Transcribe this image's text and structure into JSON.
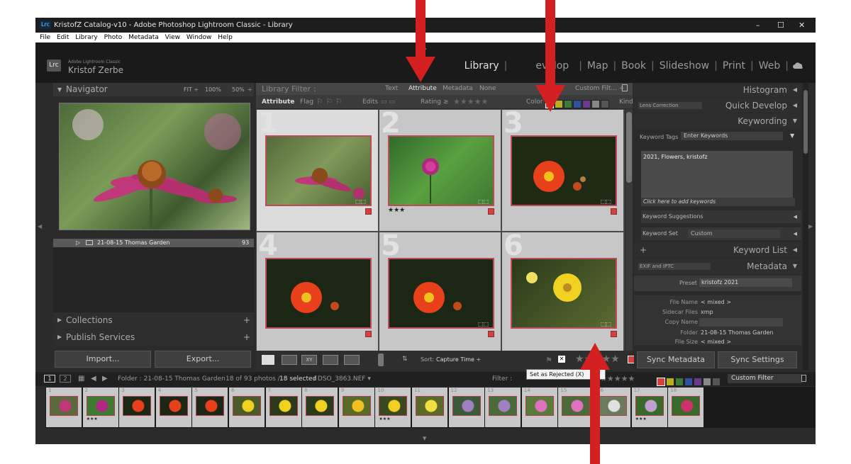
{
  "window": {
    "logo": "Lrc",
    "title": "KristofZ Catalog-v10 - Adobe Photoshop Lightroom Classic - Library",
    "controls": [
      "–",
      "☐",
      "✕"
    ]
  },
  "menu": [
    "File",
    "Edit",
    "Library",
    "Photo",
    "Metadata",
    "View",
    "Window",
    "Help"
  ],
  "identity": {
    "app_small": "Adobe Lightroom Classic",
    "user": "Kristof Zerbe",
    "badge": "Lrc"
  },
  "modules": [
    "Library",
    "Develop",
    "Map",
    "Book",
    "Slideshow",
    "Print",
    "Web"
  ],
  "modules_covered": "evelop",
  "navigator": {
    "title": "Navigator",
    "zoom_fit": "FIT ÷",
    "zoom_100": "100%",
    "zoom_50": "50%",
    "zoom_more": "÷"
  },
  "folder": {
    "name": "21-08-15 Thomas Garden",
    "count": "93"
  },
  "left_sections": [
    "Collections",
    "Publish Services"
  ],
  "left_plus": "+",
  "buttons": {
    "import": "Import...",
    "export": "Export...",
    "sync_metadata": "Sync Metadata",
    "sync_settings": "Sync Settings"
  },
  "library_filter": {
    "title": "Library Filter :",
    "tabs": [
      "Text",
      "Attribute",
      "Metadata",
      "None"
    ],
    "active_tab": "Attribute",
    "preset": "Custom Filt... ÷",
    "row_label": "Attribute",
    "flag": "Flag",
    "edits": "Edits",
    "rating": "Rating",
    "rating_op": "≥",
    "color": "Color",
    "kind": "Kind"
  },
  "grid": {
    "cells": [
      {
        "num": "1",
        "stars": ""
      },
      {
        "num": "2",
        "stars": "★★★"
      },
      {
        "num": "3",
        "stars": ""
      },
      {
        "num": "4",
        "stars": ""
      },
      {
        "num": "5",
        "stars": ""
      },
      {
        "num": "6",
        "stars": ""
      }
    ]
  },
  "toolbar": {
    "sort_label": "Sort:",
    "sort_value": "Capture Time ÷",
    "stars": "★★★★★",
    "tooltip": "Set as Rejected (X)"
  },
  "right": {
    "histogram": "Histogram",
    "quick_develop": "Quick Develop",
    "lens_correction": "Lens Correction",
    "keywording": "Keywording",
    "keyword_tags_label": "Keyword Tags",
    "keyword_tags_value": "Enter Keywords",
    "keywords": "2021, Flowers, kristofz",
    "add_keywords": "Click here to add keywords",
    "keyword_suggestions": "Keyword Suggestions",
    "keyword_set_label": "Keyword Set",
    "keyword_set_value": "Custom",
    "keyword_list": "Keyword List",
    "metadata": "Metadata",
    "exif_preset": "EXIF and IPTC",
    "preset_label": "Preset",
    "preset_value": "kristofz 2021",
    "fields": [
      {
        "label": "File Name",
        "value": "< mixed >"
      },
      {
        "label": "Sidecar Files",
        "value": "xmp"
      },
      {
        "label": "Copy Name",
        "value": ""
      },
      {
        "label": "Folder",
        "value": "21-08-15 Thomas Garden"
      },
      {
        "label": "File Size",
        "value": "< mixed >"
      }
    ]
  },
  "filmbar": {
    "page1": "1",
    "page2": "2",
    "folder": "Folder : 21-08-15 Thomas Garden",
    "count": "18 of 93 photos /",
    "selected": "18 selected",
    "file": "/ DSO_3863.NEF ▾",
    "filter": "Filter :",
    "custom_filter": "Custom Filter"
  },
  "filmstrip": {
    "cells": [
      {
        "num": "1",
        "stars": ""
      },
      {
        "num": "2",
        "stars": "★★★"
      },
      {
        "num": "3",
        "stars": ""
      },
      {
        "num": "4",
        "stars": ""
      },
      {
        "num": "5",
        "stars": ""
      },
      {
        "num": "6",
        "stars": ""
      },
      {
        "num": "7",
        "stars": ""
      },
      {
        "num": "8",
        "stars": ""
      },
      {
        "num": "9",
        "stars": ""
      },
      {
        "num": "10",
        "stars": "★★★"
      },
      {
        "num": "11",
        "stars": ""
      },
      {
        "num": "12",
        "stars": ""
      },
      {
        "num": "13",
        "stars": ""
      },
      {
        "num": "14",
        "stars": ""
      },
      {
        "num": "15",
        "stars": ""
      },
      {
        "num": "16",
        "stars": ""
      },
      {
        "num": "17",
        "stars": "★★★"
      },
      {
        "num": "18",
        "stars": ""
      }
    ]
  },
  "colors": {
    "accent_red": "#d42020",
    "label_red": "#d84040",
    "label_yellow": "#e2d81c",
    "label_green": "#3a8a3a",
    "label_blue": "#3050b0",
    "label_purple": "#7a3a9a"
  }
}
